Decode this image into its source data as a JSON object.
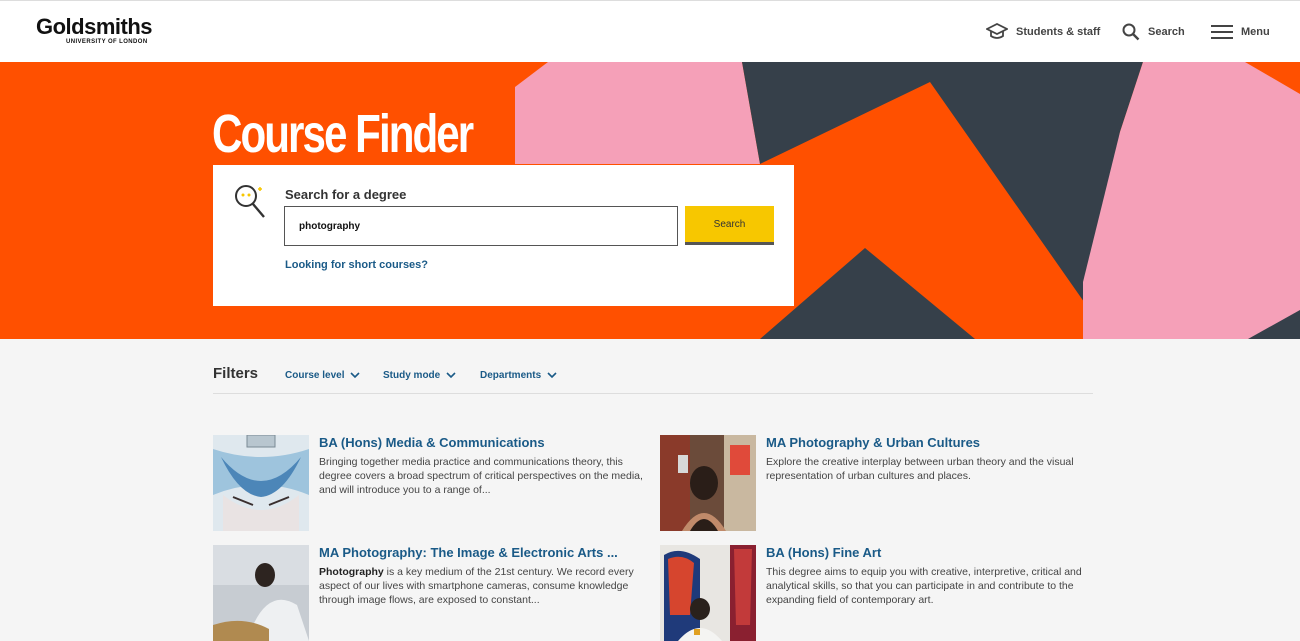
{
  "header": {
    "logo_main": "Goldsmiths",
    "logo_sub": "UNIVERSITY OF LONDON",
    "nav": [
      {
        "label": "Students & staff",
        "icon": "graduation-cap-icon"
      },
      {
        "label": "Search",
        "icon": "search-icon"
      },
      {
        "label": "Menu",
        "icon": "hamburger-icon"
      }
    ]
  },
  "hero": {
    "title": "Course Finder",
    "colors": {
      "orange": "#ff5000",
      "pink": "#f5a0b8",
      "slate": "#36404a"
    },
    "search": {
      "label": "Search for a degree",
      "value": "photography",
      "button": "Search",
      "short_courses_link": "Looking for short courses?"
    }
  },
  "filters": {
    "title": "Filters",
    "dropdowns": [
      "Course level",
      "Study mode",
      "Departments"
    ]
  },
  "results": [
    {
      "title": "BA (Hons) Media & Communications",
      "desc": "Bringing together media practice and communications theory, this degree covers a broad spectrum of critical perspectives on the media, and will introduce you to a range of..."
    },
    {
      "title": "MA Photography & Urban Cultures",
      "desc": "Explore the creative interplay between urban theory and the visual representation of urban cultures and places."
    },
    {
      "title": "MA Photography: The Image & Electronic Arts ...",
      "desc_bold": "Photography",
      "desc": " is a key medium of the 21st century. We record every aspect of our lives with smartphone cameras, consume knowledge through image flows, are exposed to constant..."
    },
    {
      "title": "BA (Hons) Fine Art",
      "desc": "This degree aims to equip you with creative, interpretive, critical and analytical skills, so that you can participate in and contribute to the expanding field of contemporary art."
    }
  ]
}
